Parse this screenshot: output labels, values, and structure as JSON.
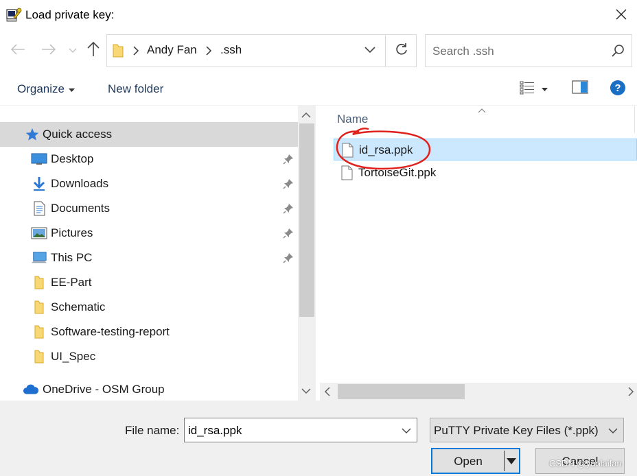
{
  "window": {
    "title": "Load private key:",
    "close_icon": "close-icon",
    "app_icon": "putty-key-icon"
  },
  "nav": {
    "back_icon": "arrow-left-icon",
    "forward_icon": "arrow-right-icon",
    "recent_icon": "chevron-down-icon",
    "up_icon": "arrow-up-icon"
  },
  "address": {
    "crumbs": [
      "Andy Fan",
      ".ssh"
    ],
    "dropdown_icon": "chevron-down-icon",
    "refresh_icon": "refresh-icon"
  },
  "search": {
    "placeholder": "Search .ssh",
    "icon": "search-icon"
  },
  "toolbar": {
    "organize_label": "Organize",
    "new_folder_label": "New folder",
    "view_icon": "details-view-icon",
    "preview_icon": "preview-pane-icon",
    "help_icon": "help-icon"
  },
  "sidebar": {
    "items": [
      {
        "label": "Quick access",
        "icon": "star-icon",
        "pinned": false,
        "selected": true
      },
      {
        "label": "Desktop",
        "icon": "desktop-icon",
        "pinned": true
      },
      {
        "label": "Downloads",
        "icon": "download-icon",
        "pinned": true
      },
      {
        "label": "Documents",
        "icon": "document-icon",
        "pinned": true
      },
      {
        "label": "Pictures",
        "icon": "picture-icon",
        "pinned": true
      },
      {
        "label": "This PC",
        "icon": "computer-icon",
        "pinned": true
      },
      {
        "label": "EE-Part",
        "icon": "folder-icon",
        "pinned": false
      },
      {
        "label": "Schematic",
        "icon": "folder-icon",
        "pinned": false
      },
      {
        "label": "Software-testing-report",
        "icon": "folder-icon",
        "pinned": false
      },
      {
        "label": "UI_Spec",
        "icon": "folder-icon",
        "pinned": false
      },
      {
        "label": "OneDrive - OSM Group",
        "icon": "cloud-icon",
        "pinned": false
      }
    ]
  },
  "files": {
    "column_name": "Name",
    "rows": [
      {
        "name": "id_rsa.ppk",
        "selected": true
      },
      {
        "name": "TortoiseGit.ppk",
        "selected": false
      }
    ]
  },
  "footer": {
    "file_name_label": "File name:",
    "file_name_value": "id_rsa.ppk",
    "filter_label": "PuTTY Private Key Files (*.ppk)",
    "open_label": "Open",
    "cancel_label": "Cancel",
    "watermark": "CSDN @yanlaifan"
  },
  "colors": {
    "selection_bg": "#cce8ff",
    "nav_selected_bg": "#d9d9d9",
    "accent": "#0078d7",
    "annotation_red": "#e0201b",
    "link_text": "#1e395b"
  }
}
